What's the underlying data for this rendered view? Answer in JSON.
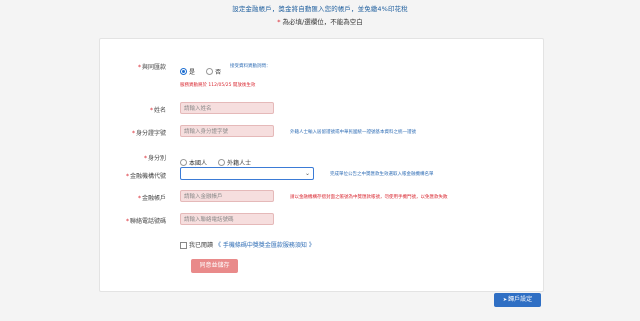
{
  "header": {
    "line1": "設定金融帳戶，獎金將自動匯入您的帳戶，並免繳4%印花稅",
    "required_star": "*",
    "line2": "為必填/選欄位，不能為空白"
  },
  "form": {
    "data_auth": {
      "label": "與同匯款",
      "option_yes": "是",
      "option_no": "否",
      "hint": "接受資料異動詞問：",
      "notice": "服務異動將於 112/05/25 開放後生效"
    },
    "name": {
      "label": "姓名",
      "placeholder": "請輸入姓名"
    },
    "id_number": {
      "label": "身分證字號",
      "placeholder": "請輸入身分證字號",
      "hint": "外籍人士輸入居留證號或中華民國統一證號基本資料之統一證號"
    },
    "identity": {
      "label": "身分別",
      "option_local": "本國人",
      "option_foreign": "外籍人士"
    },
    "bank_code": {
      "label": "金融機構代號",
      "value": "",
      "hint": "完成單位公告之中獎匯款生效選取入帳金融機構名單"
    },
    "account": {
      "label": "金融帳戶",
      "placeholder": "請輸入金融帳戶",
      "hint": "請以金融機構存摺封面之帳號為中獎匯款帳號，勿使用手機門號，以免匯款失敗"
    },
    "phone": {
      "label": "聯絡電話號碼",
      "placeholder": "請輸入聯絡電話號碼"
    },
    "consent": {
      "prefix": "我已閱讀",
      "link": "《 手機條碼中獎獎金匯款服務須知 》"
    },
    "save_button": "同意並儲存"
  },
  "footer": {
    "setup_button": "歸戶設定",
    "setup_icon": "arrow-right-icon"
  },
  "colors": {
    "required": "#d9262f",
    "link_blue": "#2f6db5",
    "input_pink": "#f6dede",
    "save_button": "#e98a8a",
    "setup_button": "#2f6fc4"
  }
}
